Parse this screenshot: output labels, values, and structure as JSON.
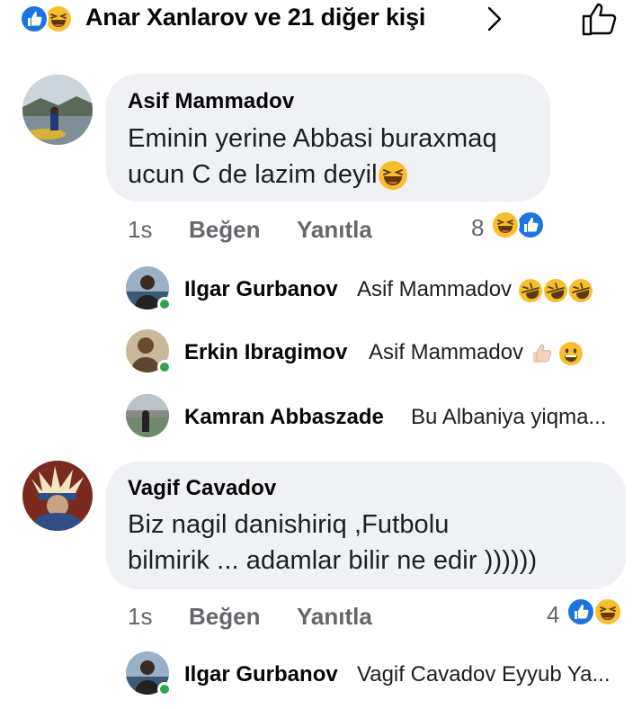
{
  "header": {
    "reactors_text": "Anar Xanlarov ve 21 diğer kişi",
    "reaction_icons": [
      "like-icon",
      "haha-icon"
    ]
  },
  "comments": [
    {
      "author": "Asif Mammadov",
      "lines": [
        "Eminin yerine Abbasi buraxmaq",
        "ucun C de lazim deyil"
      ],
      "time": "1s",
      "like_label": "Beğen",
      "reply_label": "Yanıtla",
      "reaction_count": "8",
      "reaction_icons": [
        "haha-icon",
        "like-icon"
      ],
      "replies": [
        {
          "author": "Ilgar Gurbanov",
          "text": "Asif Mammadov",
          "emoji": [
            "rofl-icon",
            "rofl-icon",
            "rofl-icon"
          ],
          "online": true
        },
        {
          "author": "Erkin Ibragimov",
          "text": "Asif Mammadov",
          "emoji": [
            "thumbs-up-icon",
            "smile-icon"
          ],
          "online": true
        },
        {
          "author": "Kamran Abbaszade",
          "text": "Bu Albaniya yiqma...",
          "emoji": [],
          "online": false
        }
      ]
    },
    {
      "author": "Vagif Cavadov",
      "lines": [
        "Biz nagil danishiriq ,Futbolu",
        "bilmirik ... adamlar bilir ne edir ))))))"
      ],
      "time": "1s",
      "like_label": "Beğen",
      "reply_label": "Yanıtla",
      "reaction_count": "4",
      "reaction_icons": [
        "like-icon",
        "haha-icon"
      ],
      "replies": [
        {
          "author": "Ilgar Gurbanov",
          "text": "Vagif Cavadov Eyyub Ya...",
          "emoji": [],
          "online": true
        }
      ]
    }
  ],
  "colors": {
    "like_blue": "#1b74e4",
    "haha_yellow": "#f7c02b",
    "bubble_bg": "#eff1f4",
    "meta_gray": "#65676b",
    "online_green": "#31a24c"
  }
}
